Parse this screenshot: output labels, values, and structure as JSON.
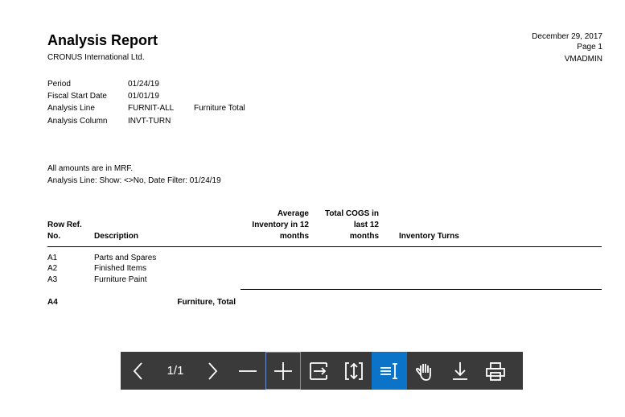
{
  "report": {
    "title": "Analysis Report",
    "company": "CRONUS International Ltd.",
    "date": "December 29, 2017",
    "page": "Page 1",
    "user": "VMADMIN"
  },
  "params": [
    {
      "label": "Period",
      "value": "01/24/19",
      "extra": ""
    },
    {
      "label": "Fiscal Start Date",
      "value": "01/01/19",
      "extra": ""
    },
    {
      "label": "Analysis Line",
      "value": "FURNIT-ALL",
      "extra": "Furniture Total"
    },
    {
      "label": "Analysis Column",
      "value": "INVT-TURN",
      "extra": ""
    }
  ],
  "notes": {
    "amounts": "All amounts are in MRF.",
    "filter": "Analysis Line: Show: <>No, Date Filter: 01/24/19"
  },
  "columns": {
    "row_ref_1": "Row Ref.",
    "row_ref_2": "No.",
    "description": "Description",
    "avg_inv_1": "Average",
    "avg_inv_2": "Inventory in 12",
    "avg_inv_3": "months",
    "cogs_1": "Total COGS in",
    "cogs_2": "last 12",
    "cogs_3": "months",
    "turns": "Inventory Turns"
  },
  "rows": [
    {
      "ref": "A1",
      "desc": "Parts and Spares"
    },
    {
      "ref": "A2",
      "desc": "Finished Items"
    },
    {
      "ref": "A3",
      "desc": "Furniture Paint"
    }
  ],
  "total": {
    "ref": "A4",
    "desc": "Furniture, Total"
  },
  "toolbar": {
    "page_indicator": "1/1",
    "icons": [
      "chevron-left-icon",
      "chevron-right-icon",
      "zoom-out-icon",
      "zoom-in-icon",
      "fit-width-icon",
      "fit-page-icon",
      "text-select-icon",
      "hand-pan-icon",
      "download-icon",
      "print-icon"
    ],
    "active_color": "#0b74c8",
    "bg_color": "#3a3a3a"
  }
}
